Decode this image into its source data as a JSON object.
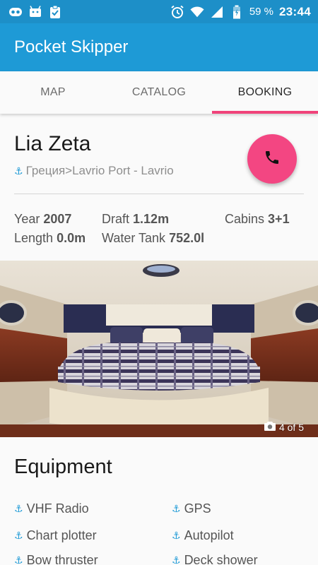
{
  "status_bar": {
    "battery_percent": "59 %",
    "time": "23:44",
    "icons": [
      "voicemail-icon",
      "android-icon",
      "clipboard-check-icon",
      "alarm-icon",
      "wifi-icon",
      "signal-icon",
      "battery-charging-icon"
    ]
  },
  "app": {
    "title": "Pocket Skipper"
  },
  "tabs": [
    {
      "label": "MAP",
      "active": false
    },
    {
      "label": "CATALOG",
      "active": false
    },
    {
      "label": "BOOKING",
      "active": true
    }
  ],
  "boat": {
    "name": "Lia Zeta",
    "location": "Греция>Lavrio Port - Lavrio",
    "specs": {
      "year_label": "Year",
      "year_value": "2007",
      "draft_label": "Draft",
      "draft_value": "1.12m",
      "cabins_label": "Cabins",
      "cabins_value": "3+1",
      "length_label": "Length",
      "length_value": "0.0m",
      "water_label": "Water Tank",
      "water_value": "752.0l"
    }
  },
  "gallery": {
    "counter": "4 of 5"
  },
  "equipment": {
    "title": "Equipment",
    "items": [
      "VHF Radio",
      "GPS",
      "Chart plotter",
      "Autopilot",
      "Bow thruster",
      "Deck shower"
    ]
  },
  "colors": {
    "status_bar": "#1d8fc8",
    "app_bar": "#1e9ad6",
    "accent": "#f34682",
    "tab_indicator": "#f0437a"
  }
}
